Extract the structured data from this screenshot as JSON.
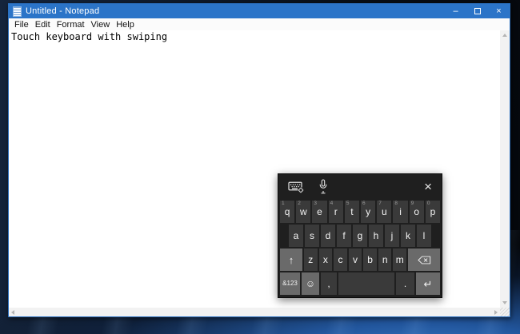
{
  "window": {
    "title": "Untitled - Notepad",
    "controls": {
      "minimize": "–",
      "close": "×"
    },
    "menu": {
      "items": [
        "File",
        "Edit",
        "Format",
        "View",
        "Help"
      ]
    },
    "document_text": "Touch keyboard with swiping"
  },
  "keyboard": {
    "close": "×",
    "rows": [
      {
        "keys": [
          {
            "id": "q",
            "label": "q",
            "hint": "1"
          },
          {
            "id": "w",
            "label": "w",
            "hint": "2"
          },
          {
            "id": "e",
            "label": "e",
            "hint": "3"
          },
          {
            "id": "r",
            "label": "r",
            "hint": "4"
          },
          {
            "id": "t",
            "label": "t",
            "hint": "5"
          },
          {
            "id": "y",
            "label": "y",
            "hint": "6"
          },
          {
            "id": "u",
            "label": "u",
            "hint": "7"
          },
          {
            "id": "i",
            "label": "i",
            "hint": "8"
          },
          {
            "id": "o",
            "label": "o",
            "hint": "9"
          },
          {
            "id": "p",
            "label": "p",
            "hint": "0"
          }
        ]
      },
      {
        "keys": [
          {
            "id": "a",
            "label": "a"
          },
          {
            "id": "s",
            "label": "s"
          },
          {
            "id": "d",
            "label": "d"
          },
          {
            "id": "f",
            "label": "f"
          },
          {
            "id": "g",
            "label": "g"
          },
          {
            "id": "h",
            "label": "h"
          },
          {
            "id": "j",
            "label": "j"
          },
          {
            "id": "k",
            "label": "k"
          },
          {
            "id": "l",
            "label": "l"
          }
        ]
      },
      {
        "keys": [
          {
            "id": "shift",
            "label": "↑",
            "type": "special"
          },
          {
            "id": "z",
            "label": "z"
          },
          {
            "id": "x",
            "label": "x"
          },
          {
            "id": "c",
            "label": "c"
          },
          {
            "id": "v",
            "label": "v"
          },
          {
            "id": "b",
            "label": "b"
          },
          {
            "id": "n",
            "label": "n"
          },
          {
            "id": "m",
            "label": "m"
          },
          {
            "id": "backspace",
            "icon": "backspace",
            "type": "special"
          }
        ]
      },
      {
        "keys": [
          {
            "id": "symbols",
            "label": "&123",
            "type": "special"
          },
          {
            "id": "emoji",
            "label": "☺",
            "type": "special"
          },
          {
            "id": "comma",
            "label": ","
          },
          {
            "id": "space",
            "label": ""
          },
          {
            "id": "period",
            "label": "."
          },
          {
            "id": "enter",
            "label": "↵",
            "type": "special"
          }
        ]
      }
    ]
  },
  "colors": {
    "titlebar_accent": "#2b74c8",
    "keyboard_background": "#1f1f1f",
    "key_normal": "#3a3a3a",
    "key_special": "#6a6a6a",
    "wallpaper_blue": "#2e7bd4"
  }
}
